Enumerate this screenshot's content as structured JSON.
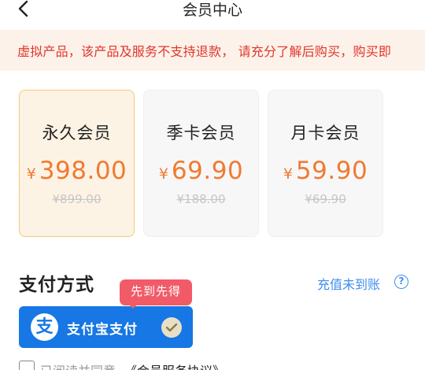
{
  "header": {
    "title": "会员中心",
    "back_icon": "chevron-left-icon"
  },
  "notice": {
    "text": "虚拟产品，该产品及服务不支持退款， 请充分了解后购买，购买即"
  },
  "plans": [
    {
      "name": "永久会员",
      "currency": "¥",
      "price": "398.00",
      "original": "¥899.00",
      "selected": true
    },
    {
      "name": "季卡会员",
      "currency": "¥",
      "price": "69.90",
      "original": "¥188.00",
      "selected": false
    },
    {
      "name": "月卡会员",
      "currency": "¥",
      "price": "59.90",
      "original": "¥69.90",
      "selected": false
    }
  ],
  "payment": {
    "title": "支付方式",
    "unpaid_link": "充值未到账",
    "help_icon": "question-circle-icon",
    "promo_badge": "先到先得",
    "method_label": "支付宝支付",
    "method_icon": "alipay-icon",
    "method_logo_char": "支",
    "selected_icon": "check-circle-icon"
  },
  "agreement": {
    "prefix": "已阅读并同意",
    "link": "《会员服务协议》"
  },
  "colors": {
    "accent_orange": "#f07a32",
    "warning_red": "#e0352b",
    "alipay_blue": "#1677e5",
    "link_blue": "#3f8ef0",
    "badge_red": "#f15b67",
    "selected_border": "#f3c97a"
  }
}
